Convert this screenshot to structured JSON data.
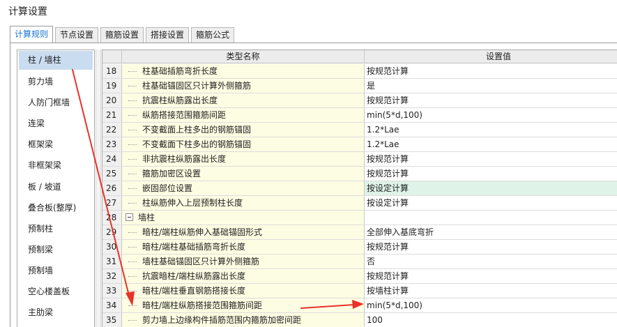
{
  "window": {
    "title": "计算设置"
  },
  "tabs": [
    {
      "label": "计算规则",
      "active": true
    },
    {
      "label": "节点设置",
      "active": false
    },
    {
      "label": "箍筋设置",
      "active": false
    },
    {
      "label": "搭接设置",
      "active": false
    },
    {
      "label": "箍筋公式",
      "active": false
    }
  ],
  "sidebar": {
    "items": [
      {
        "label": "柱 / 墙柱",
        "active": true
      },
      {
        "label": "剪力墙"
      },
      {
        "label": "人防门框墙"
      },
      {
        "label": "连梁"
      },
      {
        "label": "框架梁"
      },
      {
        "label": "非框架梁"
      },
      {
        "label": "板 / 坡道"
      },
      {
        "label": "叠合板(整厚)"
      },
      {
        "label": "预制柱"
      },
      {
        "label": "预制梁"
      },
      {
        "label": "预制墙"
      },
      {
        "label": "空心楼盖板"
      },
      {
        "label": "主肋梁"
      }
    ]
  },
  "grid": {
    "headers": {
      "name": "类型名称",
      "value": "设置值"
    },
    "rows": [
      {
        "num": "18",
        "name": "柱基础插筋弯折长度",
        "value": "按规范计算"
      },
      {
        "num": "19",
        "name": "柱基础锚固区只计算外侧箍筋",
        "value": "是"
      },
      {
        "num": "20",
        "name": "抗震柱纵筋露出长度",
        "value": "按规范计算"
      },
      {
        "num": "21",
        "name": "纵筋搭接范围箍筋间距",
        "value": "min(5*d,100)"
      },
      {
        "num": "22",
        "name": "不变截面上柱多出的钢筋锚固",
        "value": "1.2*Lae"
      },
      {
        "num": "23",
        "name": "不变截面下柱多出的钢筋锚固",
        "value": "1.2*Lae"
      },
      {
        "num": "24",
        "name": "非抗震柱纵筋露出长度",
        "value": "按规范计算"
      },
      {
        "num": "25",
        "name": "箍筋加密区设置",
        "value": "按规范计算"
      },
      {
        "num": "26",
        "name": "嵌固部位设置",
        "value": "按设定计算",
        "highlight": true
      },
      {
        "num": "27",
        "name": "柱纵筋伸入上层预制柱长度",
        "value": "按设定计算"
      },
      {
        "num": "28",
        "name": "墙柱",
        "value": "",
        "group": true
      },
      {
        "num": "29",
        "name": "暗柱/端柱纵筋伸入基础锚固形式",
        "value": "全部伸入基底弯折"
      },
      {
        "num": "30",
        "name": "暗柱/端柱基础插筋弯折长度",
        "value": "按规范计算"
      },
      {
        "num": "31",
        "name": "墙柱基础锚固区只计算外侧箍筋",
        "value": "否"
      },
      {
        "num": "32",
        "name": "抗震暗柱/端柱纵筋露出长度",
        "value": "按规范计算"
      },
      {
        "num": "33",
        "name": "暗柱/端柱垂直钢筋搭接长度",
        "value": "按墙柱计算"
      },
      {
        "num": "34",
        "name": "暗柱/端柱纵筋搭接范围箍筋间距",
        "value": "min(5*d,100)"
      },
      {
        "num": "35",
        "name": "剪力墙上边缘构件插筋范围内箍筋加密间距",
        "value": "100"
      }
    ]
  },
  "colors": {
    "accent": "#1a73d1",
    "annotation": "#e8322a",
    "name_column_bg": "#fdfde3",
    "highlight_bg": "#dff3e8",
    "selected_sidebar_bg": "#c9dcf0"
  },
  "icons": {
    "group_toggle": "collapse-minus-icon"
  }
}
